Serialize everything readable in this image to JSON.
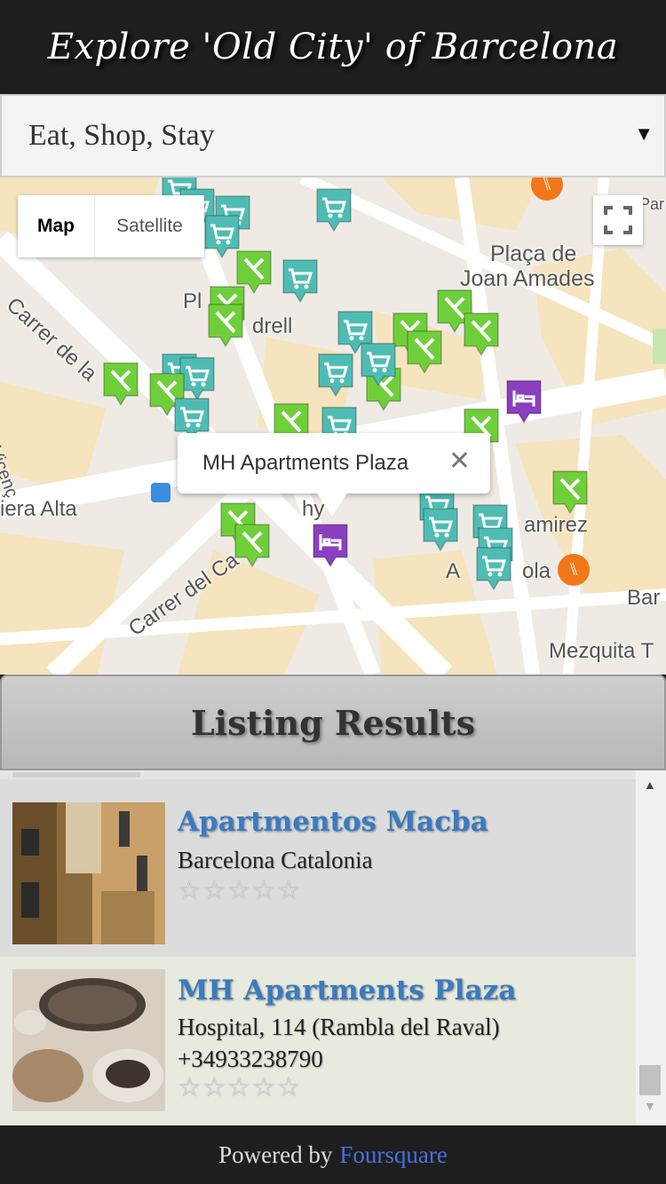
{
  "header": {
    "title": "Explore 'Old City' of Barcelona"
  },
  "filter": {
    "selected": "Eat, Shop, Stay",
    "icon": "dropdown-arrow-icon"
  },
  "map": {
    "type_control": {
      "map_label": "Map",
      "satellite_label": "Satellite"
    },
    "fullscreen_icon": "fullscreen-icon",
    "labels": {
      "placa": "Plaça de",
      "joan": "Joan Amades",
      "carrer_de": "Carrer de la",
      "carrer_del": "Carrer del Ca",
      "iera_alta": "iera Alta",
      "vicenc": "Vicenç",
      "pl": "Pl",
      "drell": "drell",
      "amirez": "amirez",
      "a_ola": "A",
      "ola": "ola",
      "bar": "Bar",
      "mezquita": "Mezquita T",
      "par": "Par",
      "hy": "hy"
    },
    "infowindow": {
      "title": "MH Apartments Plaza"
    },
    "colors": {
      "eat": "#6fcf3a",
      "shop": "#4fbcb3",
      "stay": "#8a3fc0",
      "poi": "#f2771b"
    }
  },
  "listing": {
    "title": "Listing Results",
    "items": [
      {
        "name": "Apartmentos Macba",
        "line1": "Barcelona Catalonia",
        "line2": "",
        "stars": "☆☆☆☆☆"
      },
      {
        "name": "MH Apartments Plaza",
        "line1": "Hospital, 114 (Rambla del Raval)",
        "line2": "+34933238790",
        "stars": "☆☆☆☆☆"
      }
    ]
  },
  "footer": {
    "prefix": "Powered by",
    "link": "Foursquare"
  }
}
